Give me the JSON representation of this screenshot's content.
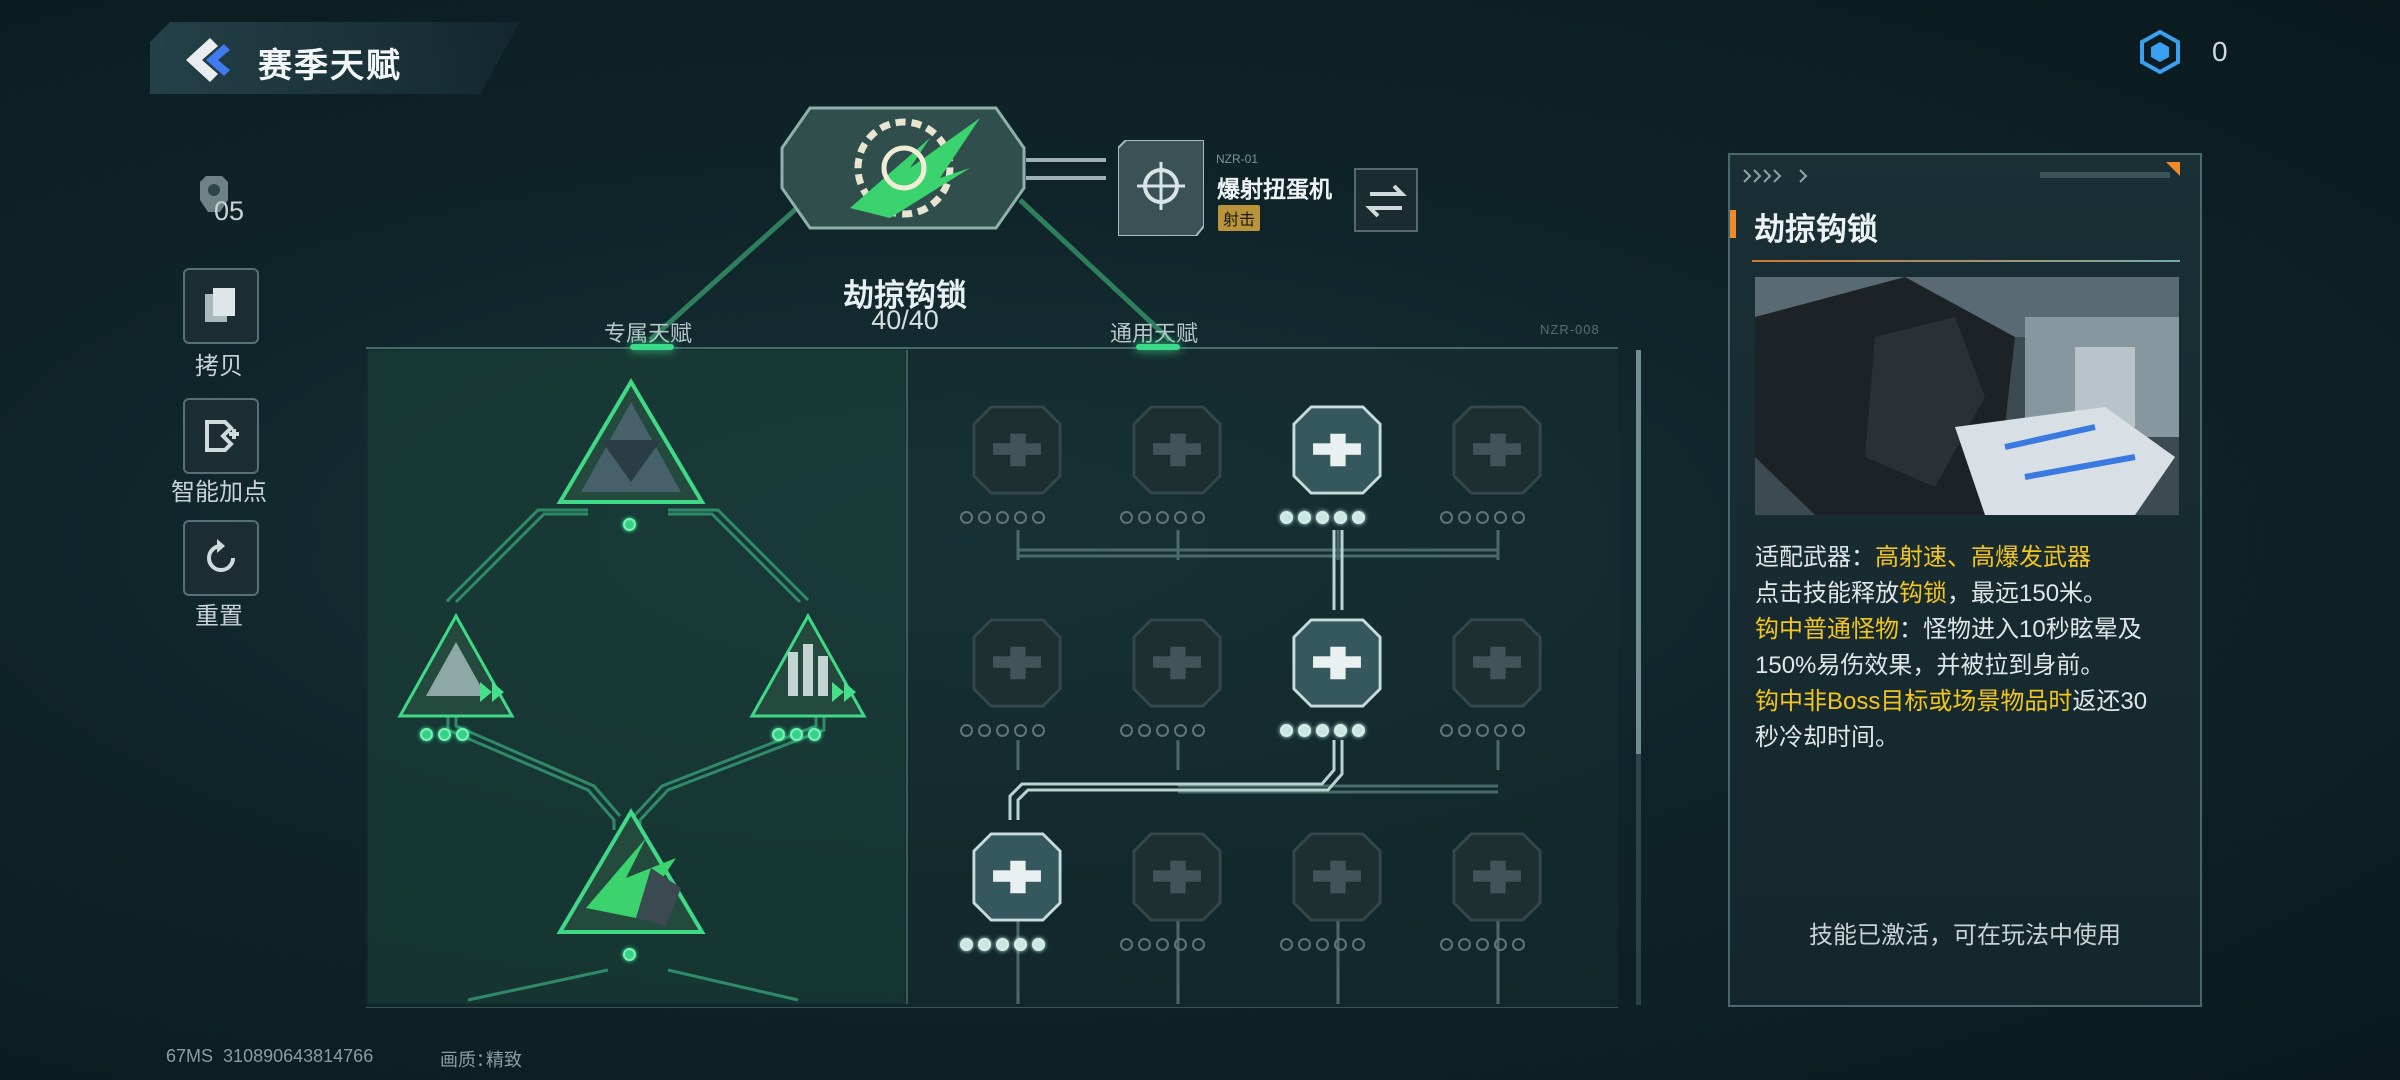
{
  "header": {
    "title": "赛季天赋",
    "currency_value": "0",
    "currency_icon": "hexagon-core-icon"
  },
  "sidebar": {
    "points_value": "05",
    "buttons": [
      {
        "label": "拷贝",
        "icon": "copy-icon"
      },
      {
        "label": "智能加点",
        "icon": "smart-points-icon"
      },
      {
        "label": "重置",
        "icon": "reset-icon"
      }
    ]
  },
  "main_skill": {
    "name": "劫掠钩锁",
    "progress": "40/40",
    "progress_current": 40,
    "progress_max": 40
  },
  "weapon": {
    "code": "NZR-01",
    "name": "爆射扭蛋机",
    "tag": "射击"
  },
  "tabs": {
    "exclusive": "专属天赋",
    "general": "通用天赋"
  },
  "tree_code": "NZR-008",
  "exclusive_nodes": [
    {
      "id": "top",
      "level": 1,
      "max": 1,
      "active": true
    },
    {
      "id": "left",
      "level": 3,
      "max": 3,
      "active": true
    },
    {
      "id": "right",
      "level": 3,
      "max": 3,
      "active": true
    },
    {
      "id": "bottom",
      "level": 1,
      "max": 1,
      "active": true
    }
  ],
  "general_nodes": [
    {
      "row": 1,
      "col": 1,
      "level": 0,
      "max": 5,
      "active": false
    },
    {
      "row": 1,
      "col": 2,
      "level": 0,
      "max": 5,
      "active": false
    },
    {
      "row": 1,
      "col": 3,
      "level": 5,
      "max": 5,
      "active": true
    },
    {
      "row": 1,
      "col": 4,
      "level": 0,
      "max": 5,
      "active": false
    },
    {
      "row": 2,
      "col": 1,
      "level": 0,
      "max": 5,
      "active": false
    },
    {
      "row": 2,
      "col": 2,
      "level": 0,
      "max": 5,
      "active": false
    },
    {
      "row": 2,
      "col": 3,
      "level": 5,
      "max": 5,
      "active": true
    },
    {
      "row": 2,
      "col": 4,
      "level": 0,
      "max": 5,
      "active": false
    },
    {
      "row": 3,
      "col": 1,
      "level": 5,
      "max": 5,
      "active": true
    },
    {
      "row": 3,
      "col": 2,
      "level": 0,
      "max": 5,
      "active": false
    },
    {
      "row": 3,
      "col": 3,
      "level": 0,
      "max": 5,
      "active": false
    },
    {
      "row": 3,
      "col": 4,
      "level": 0,
      "max": 5,
      "active": false
    }
  ],
  "info": {
    "title": "劫掠钩锁",
    "l1_pre": "适配武器：",
    "l1_hl": "高射速、高爆发武器",
    "l2_pre": "点击技能释放",
    "l2_hl": "钩锁",
    "l2_post": "，最远150米。",
    "l3_hl": "钩中普通怪物",
    "l3_post": "：怪物进入10秒眩晕及",
    "l4": "150%易伤效果，并被拉到身前。",
    "l5_hl": "钩中非Boss目标或场景物品时",
    "l5_post": "返还30",
    "l6": "秒冷却时间。",
    "status": "技能已激活，可在玩法中使用"
  },
  "footer": {
    "ping": "67MS",
    "uid": "310890643814766",
    "quality_label": "画质：",
    "quality_value": "精致"
  },
  "colors": {
    "accent_green": "#37d28a",
    "highlight_yellow": "#f3c51f",
    "accent_orange": "#f08a2a"
  }
}
